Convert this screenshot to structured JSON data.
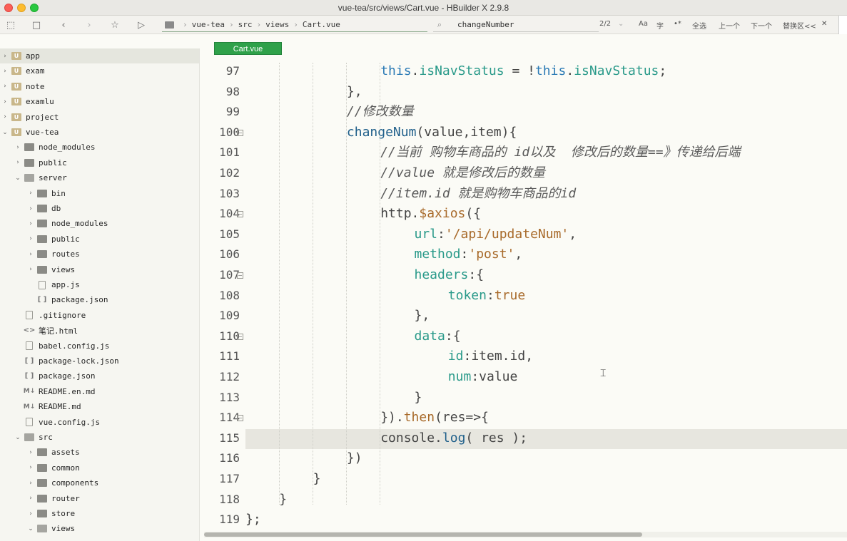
{
  "window": {
    "title": "vue-tea/src/views/Cart.vue - HBuilder X 2.9.8"
  },
  "toolbar": {
    "breadcrumb": [
      "vue-tea",
      "src",
      "views",
      "Cart.vue"
    ],
    "search_value": "changeNumber",
    "match_count": "2/2",
    "find_options": [
      "Aa",
      "字",
      "•*"
    ],
    "select_all_label": "全选",
    "prev_label": "上一个",
    "next_label": "下一个",
    "replace_label": "替换区<<",
    "close_label": "✕"
  },
  "sidebar": {
    "items": [
      {
        "label": "app",
        "level": 0,
        "type": "project",
        "expanded": false,
        "selected": true
      },
      {
        "label": "exam",
        "level": 0,
        "type": "project",
        "expanded": false
      },
      {
        "label": "note",
        "level": 0,
        "type": "project",
        "expanded": false
      },
      {
        "label": "examlu",
        "level": 0,
        "type": "project",
        "expanded": false
      },
      {
        "label": "project",
        "level": 0,
        "type": "project",
        "expanded": false
      },
      {
        "label": "vue-tea",
        "level": 0,
        "type": "project",
        "expanded": true
      },
      {
        "label": "node_modules",
        "level": 1,
        "type": "folder",
        "expanded": false
      },
      {
        "label": "public",
        "level": 1,
        "type": "folder",
        "expanded": false
      },
      {
        "label": "server",
        "level": 1,
        "type": "folder",
        "expanded": true
      },
      {
        "label": "bin",
        "level": 2,
        "type": "folder",
        "expanded": false
      },
      {
        "label": "db",
        "level": 2,
        "type": "folder",
        "expanded": false
      },
      {
        "label": "node_modules",
        "level": 2,
        "type": "folder",
        "expanded": false
      },
      {
        "label": "public",
        "level": 2,
        "type": "folder",
        "expanded": false
      },
      {
        "label": "routes",
        "level": 2,
        "type": "folder",
        "expanded": false
      },
      {
        "label": "views",
        "level": 2,
        "type": "folder",
        "expanded": false
      },
      {
        "label": "app.js",
        "level": 2,
        "type": "js"
      },
      {
        "label": "package.json",
        "level": 2,
        "type": "json"
      },
      {
        "label": ".gitignore",
        "level": 1,
        "type": "file"
      },
      {
        "label": "笔记.html",
        "level": 1,
        "type": "html"
      },
      {
        "label": "babel.config.js",
        "level": 1,
        "type": "js"
      },
      {
        "label": "package-lock.json",
        "level": 1,
        "type": "json"
      },
      {
        "label": "package.json",
        "level": 1,
        "type": "json"
      },
      {
        "label": "README.en.md",
        "level": 1,
        "type": "md"
      },
      {
        "label": "README.md",
        "level": 1,
        "type": "md"
      },
      {
        "label": "vue.config.js",
        "level": 1,
        "type": "js"
      },
      {
        "label": "src",
        "level": 1,
        "type": "folder",
        "expanded": true
      },
      {
        "label": "assets",
        "level": 2,
        "type": "folder",
        "expanded": false
      },
      {
        "label": "common",
        "level": 2,
        "type": "folder",
        "expanded": false
      },
      {
        "label": "components",
        "level": 2,
        "type": "folder",
        "expanded": false
      },
      {
        "label": "router",
        "level": 2,
        "type": "folder",
        "expanded": false
      },
      {
        "label": "store",
        "level": 2,
        "type": "folder",
        "expanded": false
      },
      {
        "label": "views",
        "level": 2,
        "type": "folder",
        "expanded": true
      }
    ]
  },
  "editor": {
    "active_tab": "Cart.vue",
    "current_line": 115,
    "lines": [
      {
        "num": "97",
        "fold": false,
        "tokens": [
          [
            "k",
            "this"
          ],
          [
            "o",
            "."
          ],
          [
            "p",
            "isNavStatus"
          ],
          [
            "o",
            " = !"
          ],
          [
            "k",
            "this"
          ],
          [
            "o",
            "."
          ],
          [
            "p",
            "isNavStatus"
          ],
          [
            "o",
            ";"
          ]
        ]
      },
      {
        "num": "98",
        "fold": false,
        "tokens": [
          [
            "o",
            "},"
          ]
        ]
      },
      {
        "num": "99",
        "fold": false,
        "tokens": [
          [
            "c",
            "//修改数量"
          ]
        ]
      },
      {
        "num": "100",
        "fold": true,
        "tokens": [
          [
            "f",
            "changeNum"
          ],
          [
            "o",
            "(value,item){"
          ]
        ]
      },
      {
        "num": "101",
        "fold": false,
        "tokens": [
          [
            "c",
            "//当前 购物车商品的 id以及  修改后的数量==》传递给后端"
          ]
        ]
      },
      {
        "num": "102",
        "fold": false,
        "tokens": [
          [
            "c",
            "//value 就是修改后的数量"
          ]
        ]
      },
      {
        "num": "103",
        "fold": false,
        "tokens": [
          [
            "c",
            "//item.id 就是购物车商品的id"
          ]
        ]
      },
      {
        "num": "104",
        "fold": true,
        "tokens": [
          [
            "o",
            "http."
          ],
          [
            "s",
            "$axios"
          ],
          [
            "o",
            "({"
          ]
        ]
      },
      {
        "num": "105",
        "fold": false,
        "tokens": [
          [
            "p",
            "url"
          ],
          [
            "o",
            ":"
          ],
          [
            "s",
            "'/api/updateNum'"
          ],
          [
            "o",
            ","
          ]
        ]
      },
      {
        "num": "106",
        "fold": false,
        "tokens": [
          [
            "p",
            "method"
          ],
          [
            "o",
            ":"
          ],
          [
            "s",
            "'post'"
          ],
          [
            "o",
            ","
          ]
        ]
      },
      {
        "num": "107",
        "fold": true,
        "tokens": [
          [
            "p",
            "headers"
          ],
          [
            "o",
            ":{"
          ]
        ]
      },
      {
        "num": "108",
        "fold": false,
        "tokens": [
          [
            "p",
            "token"
          ],
          [
            "o",
            ":"
          ],
          [
            "s",
            "true"
          ]
        ]
      },
      {
        "num": "109",
        "fold": false,
        "tokens": [
          [
            "o",
            "},"
          ]
        ]
      },
      {
        "num": "110",
        "fold": true,
        "tokens": [
          [
            "p",
            "data"
          ],
          [
            "o",
            ":{"
          ]
        ]
      },
      {
        "num": "111",
        "fold": false,
        "tokens": [
          [
            "p",
            "id"
          ],
          [
            "o",
            ":item."
          ],
          [
            "o",
            "id,"
          ]
        ]
      },
      {
        "num": "112",
        "fold": false,
        "tokens": [
          [
            "p",
            "num"
          ],
          [
            "o",
            ":value"
          ]
        ]
      },
      {
        "num": "113",
        "fold": false,
        "tokens": [
          [
            "o",
            "}"
          ]
        ]
      },
      {
        "num": "114",
        "fold": true,
        "tokens": [
          [
            "o",
            "})."
          ],
          [
            "s",
            "then"
          ],
          [
            "o",
            "(res=>{"
          ]
        ]
      },
      {
        "num": "115",
        "fold": false,
        "tokens": [
          [
            "o",
            "console."
          ],
          [
            "f",
            "log"
          ],
          [
            "o",
            "( res );"
          ]
        ]
      },
      {
        "num": "116",
        "fold": false,
        "tokens": [
          [
            "o",
            "})"
          ]
        ]
      },
      {
        "num": "117",
        "fold": false,
        "tokens": [
          [
            "o",
            "}"
          ]
        ]
      },
      {
        "num": "118",
        "fold": false,
        "tokens": [
          [
            "o",
            "}"
          ]
        ]
      },
      {
        "num": "119",
        "fold": false,
        "tokens": [
          [
            "o",
            "};"
          ]
        ]
      }
    ]
  },
  "colors": {
    "tab_bg": "#2fa14a",
    "keyword": "#2b7ab5",
    "property": "#2a9a8a",
    "string": "#a86a2a",
    "comment": "#5a5a5a"
  }
}
